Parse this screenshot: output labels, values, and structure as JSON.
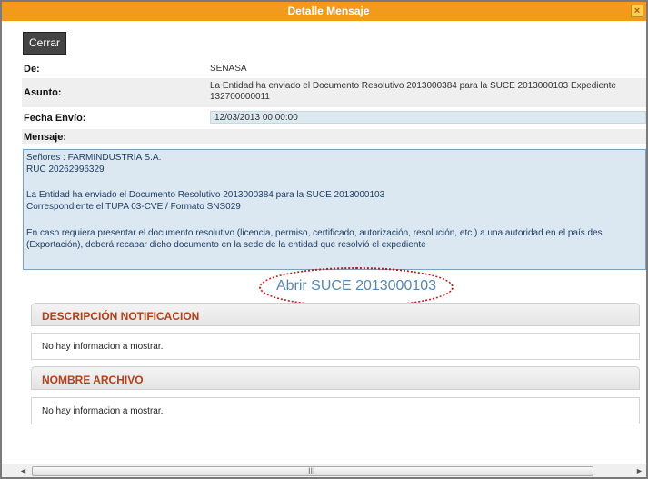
{
  "window": {
    "title": "Detalle Mensaje",
    "close_glyph": "×"
  },
  "toolbar": {
    "close_label": "Cerrar"
  },
  "fields": {
    "de": {
      "label": "De:",
      "value": "SENASA"
    },
    "asunto": {
      "label": "Asunto:",
      "value": "La Entidad ha enviado el Documento Resolutivo 2013000384 para la SUCE 2013000103 Expediente 132700000011"
    },
    "fecha": {
      "label": "Fecha Envío:",
      "value": "12/03/2013 00:00:00"
    },
    "mensaje": {
      "label": "Mensaje:"
    }
  },
  "message": {
    "lines": [
      "Señores : FARMINDUSTRIA S.A.",
      "RUC 20262996329",
      "La Entidad ha enviado el Documento Resolutivo 2013000384 para la SUCE 2013000103",
      "Correspondiente el TUPA 03-CVE / Formato SNS029",
      "En caso requiera presentar el documento resolutivo (licencia, permiso, certificado, autorización, resolución, etc.) a una autoridad en el país des",
      "(Exportación), deberá recabar dicho documento en la sede de la entidad que resolvió el expediente"
    ]
  },
  "link": {
    "label": "Abrir SUCE 2013000103"
  },
  "panels": [
    {
      "header": "DESCRIPCIÓN NOTIFICACION",
      "empty_text": "No hay informacion a mostrar."
    },
    {
      "header": "NOMBRE ARCHIVO",
      "empty_text": "No hay informacion a mostrar."
    }
  ],
  "scrollbar": {
    "left_glyph": "◄",
    "right_glyph": "►",
    "grip_glyph": "III"
  },
  "colors": {
    "titlebar": "#f39a1c",
    "panel_header_text": "#b0411a",
    "link": "#5a86ae",
    "highlight_ring": "#b51d1d"
  }
}
